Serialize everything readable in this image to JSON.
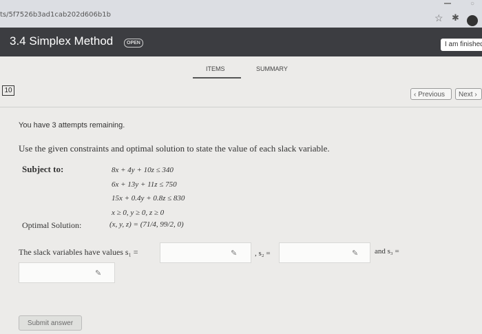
{
  "browser": {
    "url_fragment": "ts/5f7526b3ad1cab202d606b1b"
  },
  "header": {
    "title": "3.4 Simplex Method",
    "badge": "OPEN",
    "finished_button": "I am finished"
  },
  "tabs": [
    {
      "label": "ITEMS",
      "active": true
    },
    {
      "label": "SUMMARY",
      "active": false
    }
  ],
  "question": {
    "number": "10",
    "previous_label": "Previous",
    "next_label": "Next",
    "attempts_text": "You have 3 attempts remaining.",
    "instructions": "Use the given constraints and optimal solution to state the value of each slack variable.",
    "subject_label": "Subject to:",
    "constraints": [
      "8x + 4y + 10z ≤ 340",
      "6x + 13y + 11z ≤ 750",
      "15x + 0.4y + 0.8z ≤ 830",
      "x ≥ 0, y ≥ 0, z ≥ 0"
    ],
    "optimal_label": "Optimal Solution:",
    "optimal_value": "(x, y, z) = (71/4, 99/2, 0)",
    "slack_prompt": "The slack variables have values s₁ =",
    "s2_label": ", s₂ =",
    "s3_label": "and s₃ =",
    "inputs": {
      "s1": "",
      "s2": "",
      "s3": ""
    }
  },
  "footer": {
    "submit_label": "Submit answer"
  },
  "icons": [
    "star-icon",
    "extension-icon",
    "pencil-icon",
    "chevron-left-icon",
    "chevron-right-icon"
  ]
}
